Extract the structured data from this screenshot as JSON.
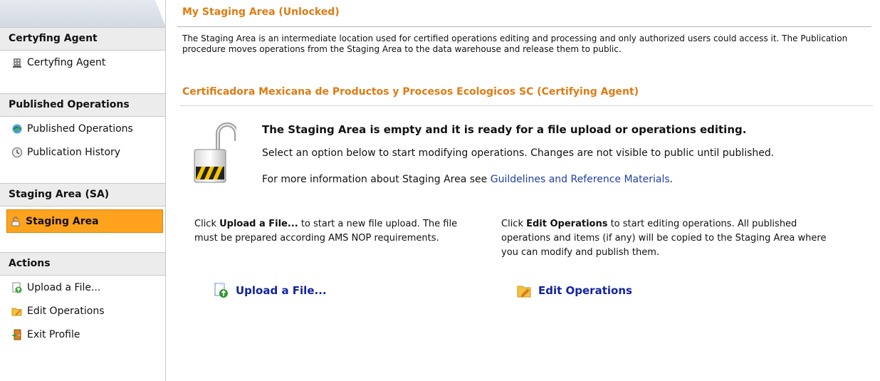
{
  "sidebar": {
    "sections": [
      {
        "header": "Certyfing Agent",
        "items": [
          {
            "label": "Certyfing Agent",
            "icon": "building-icon"
          }
        ]
      },
      {
        "header": "Published Operations",
        "items": [
          {
            "label": "Published Operations",
            "icon": "globe-check-icon"
          },
          {
            "label": "Publication History",
            "icon": "clock-history-icon"
          }
        ]
      },
      {
        "header": "Staging Area (SA)",
        "items": [
          {
            "label": "Staging Area",
            "icon": "staging-icon",
            "active": true
          }
        ]
      },
      {
        "header": "Actions",
        "items": [
          {
            "label": "Upload a File...",
            "icon": "upload-icon"
          },
          {
            "label": "Edit Operations",
            "icon": "folder-edit-icon"
          },
          {
            "label": "Exit Profile",
            "icon": "exit-door-icon"
          }
        ]
      }
    ]
  },
  "main": {
    "title": "My Staging Area (Unlocked)",
    "intro": "The Staging Area is an intermediate location used for certified operations editing and processing and only authorized users could access it. The Publication procedure moves operations from the Staging Area to the data warehouse and release them to public.",
    "agent_title": "Certificadora Mexicana de Productos y Procesos Ecologicos SC (Certifying Agent)",
    "empty_title": "The Staging Area is empty and it is ready for a file upload or operations editing.",
    "empty_line1": "Select an option below to start modifying operations. Changes are not visible to public until published.",
    "empty_line2_prefix": "For more information about Staging Area see ",
    "empty_line2_link": "Guildelines and Reference Materials",
    "empty_line2_suffix": ".",
    "left_col": {
      "prefix": "Click ",
      "bold": "Upload a File...",
      "suffix": " to start a new file upload. The file must be prepared according AMS NOP requirements."
    },
    "right_col": {
      "prefix": "Click ",
      "bold": "Edit Operations",
      "suffix": " to start editing operations. All published operations and items (if any) will be copied to the Staging Area where you can modify and publish them."
    },
    "upload_action": "Upload a File...",
    "edit_action": "Edit Operations"
  },
  "colors": {
    "accent_orange": "#e07b12",
    "active_bg": "#ffa21e",
    "link_blue": "#1f3fa6",
    "action_blue": "#12239e"
  }
}
